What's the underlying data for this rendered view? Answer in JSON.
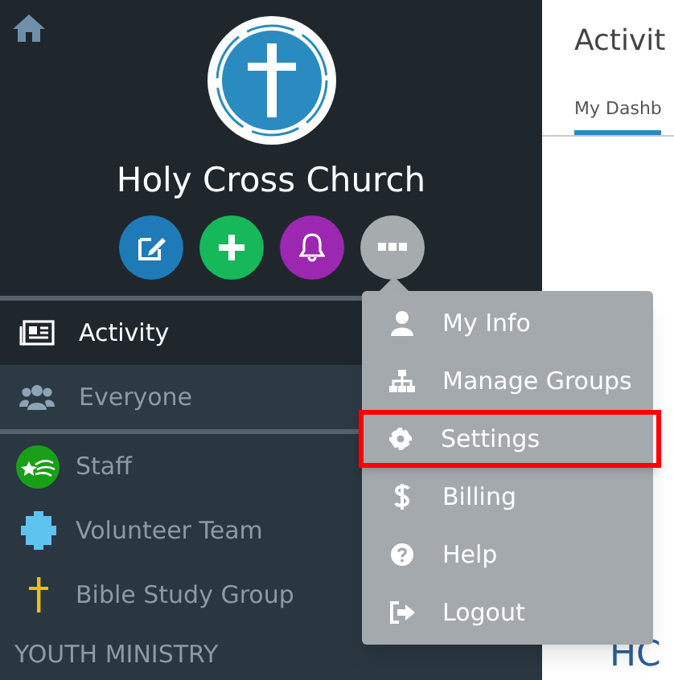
{
  "sidebar": {
    "church_name": "Holy Cross Church",
    "action_buttons": [
      {
        "kind": "compose",
        "color": "#1e7bb8"
      },
      {
        "kind": "add",
        "color": "#16b85a"
      },
      {
        "kind": "notifications",
        "color": "#9c27b0"
      },
      {
        "kind": "more",
        "color": "#a6abae"
      }
    ],
    "nav": [
      {
        "label": "Activity",
        "kind": "newspaper",
        "selected": true
      },
      {
        "label": "Everyone",
        "kind": "people",
        "selected": false
      }
    ],
    "groups": [
      {
        "label": "Staff",
        "kind": "star"
      },
      {
        "label": "Volunteer Team",
        "kind": "puzzle"
      },
      {
        "label": "Bible Study Group",
        "kind": "cross"
      }
    ],
    "section_heading": "YOUTH MINISTRY"
  },
  "main": {
    "title": "Activit",
    "tabs": [
      {
        "label": "My Dashb",
        "selected": true
      }
    ],
    "partial_heading": "HC"
  },
  "menu": {
    "items": [
      {
        "label": "My Info",
        "kind": "user",
        "highlighted": false
      },
      {
        "label": "Manage Groups",
        "kind": "sitemap",
        "highlighted": false
      },
      {
        "label": "Settings",
        "kind": "gear",
        "highlighted": true
      },
      {
        "label": "Billing",
        "kind": "dollar",
        "highlighted": false
      },
      {
        "label": "Help",
        "kind": "question",
        "highlighted": false
      },
      {
        "label": "Logout",
        "kind": "logout",
        "highlighted": false
      }
    ]
  }
}
